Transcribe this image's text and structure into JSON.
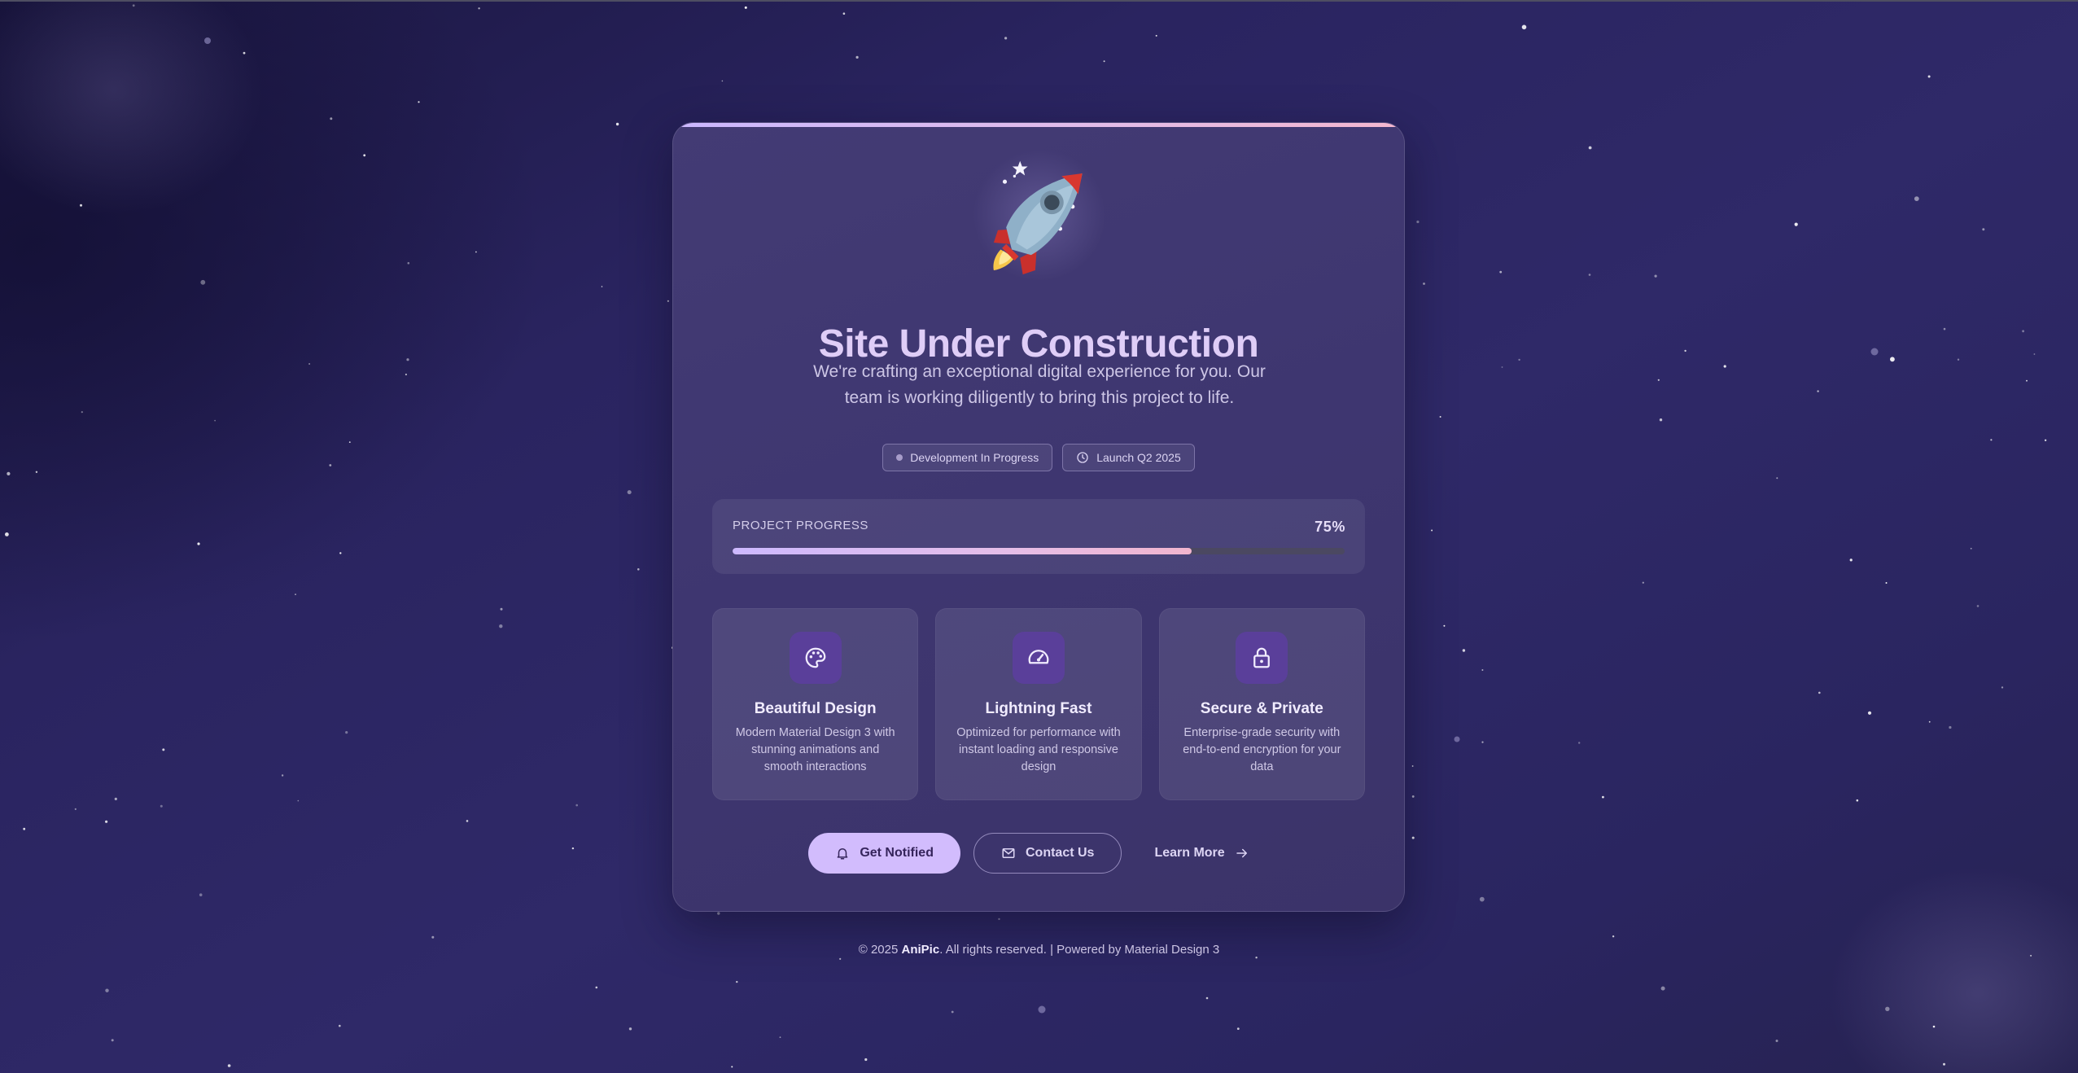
{
  "page": {
    "title": "Site Under Construction",
    "subtitle": "We're crafting an exceptional digital experience for you. Our team is working diligently to bring this project to life.",
    "hero_icon": "rocket-icon"
  },
  "chips": [
    {
      "label": "Development In Progress",
      "icon": "status-dot-icon"
    },
    {
      "label": "Launch Q2 2025",
      "icon": "clock-icon"
    }
  ],
  "progress": {
    "label": "PROJECT PROGRESS",
    "value_text": "75%",
    "fraction": 0.75
  },
  "features": [
    {
      "icon": "palette-icon",
      "title": "Beautiful Design",
      "description": "Modern Material Design 3 with stunning animations and smooth interactions"
    },
    {
      "icon": "speedometer-icon",
      "title": "Lightning Fast",
      "description": "Optimized for performance with instant loading and responsive design"
    },
    {
      "icon": "lock-icon",
      "title": "Secure & Private",
      "description": "Enterprise-grade security with end-to-end encryption for your data"
    }
  ],
  "actions": {
    "primary": {
      "label": "Get Notified",
      "icon": "bell-icon"
    },
    "secondary": {
      "label": "Contact Us",
      "icon": "mail-icon"
    },
    "tertiary": {
      "label": "Learn More",
      "icon": "arrow-right-icon"
    }
  },
  "footer": {
    "prefix": "© 2025 ",
    "brand": "AniPic",
    "suffix": ". All rights reserved. | Powered by Material Design 3"
  },
  "colors": {
    "accent": "#d2bcfd",
    "title": "#dfcdf7",
    "icon_tile": "#5a3f9a",
    "background": "#2f2968"
  }
}
